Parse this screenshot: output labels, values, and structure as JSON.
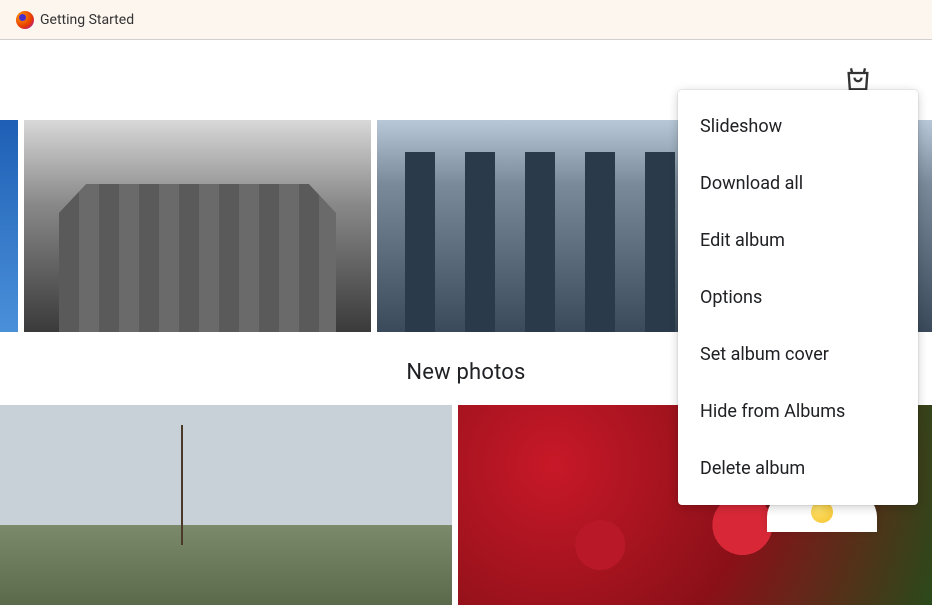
{
  "browser": {
    "tab_label": "Getting Started"
  },
  "section": {
    "title": "New photos"
  },
  "context_menu": {
    "items": [
      {
        "label": "Slideshow"
      },
      {
        "label": "Download all"
      },
      {
        "label": "Edit album"
      },
      {
        "label": "Options"
      },
      {
        "label": "Set album cover"
      },
      {
        "label": "Hide from Albums"
      },
      {
        "label": "Delete album"
      }
    ]
  }
}
